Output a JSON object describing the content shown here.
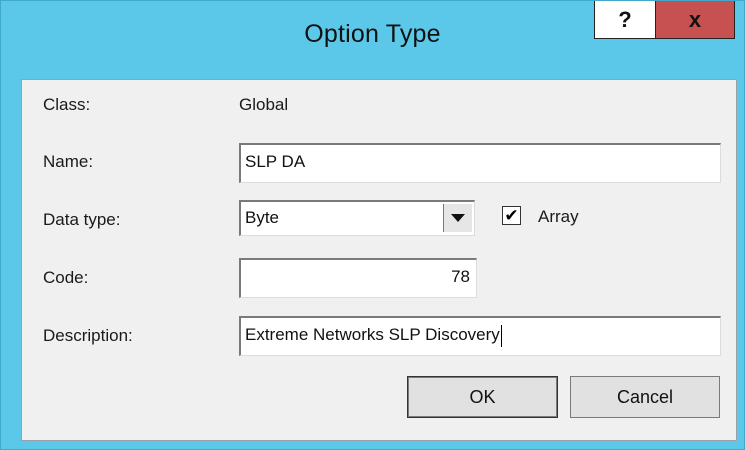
{
  "window": {
    "title": "Option Type",
    "help_label": "?",
    "close_label": "x"
  },
  "form": {
    "class": {
      "label": "Class:",
      "value": "Global"
    },
    "name": {
      "label": "Name:",
      "value": "SLP DA"
    },
    "data_type": {
      "label": "Data type:",
      "selected": "Byte"
    },
    "array": {
      "label": "Array",
      "checked": true,
      "check_mark": "✔"
    },
    "code": {
      "label": "Code:",
      "value": "78"
    },
    "description": {
      "label": "Description:",
      "value": "Extreme Networks SLP Discovery"
    }
  },
  "buttons": {
    "ok": "OK",
    "cancel": "Cancel"
  }
}
